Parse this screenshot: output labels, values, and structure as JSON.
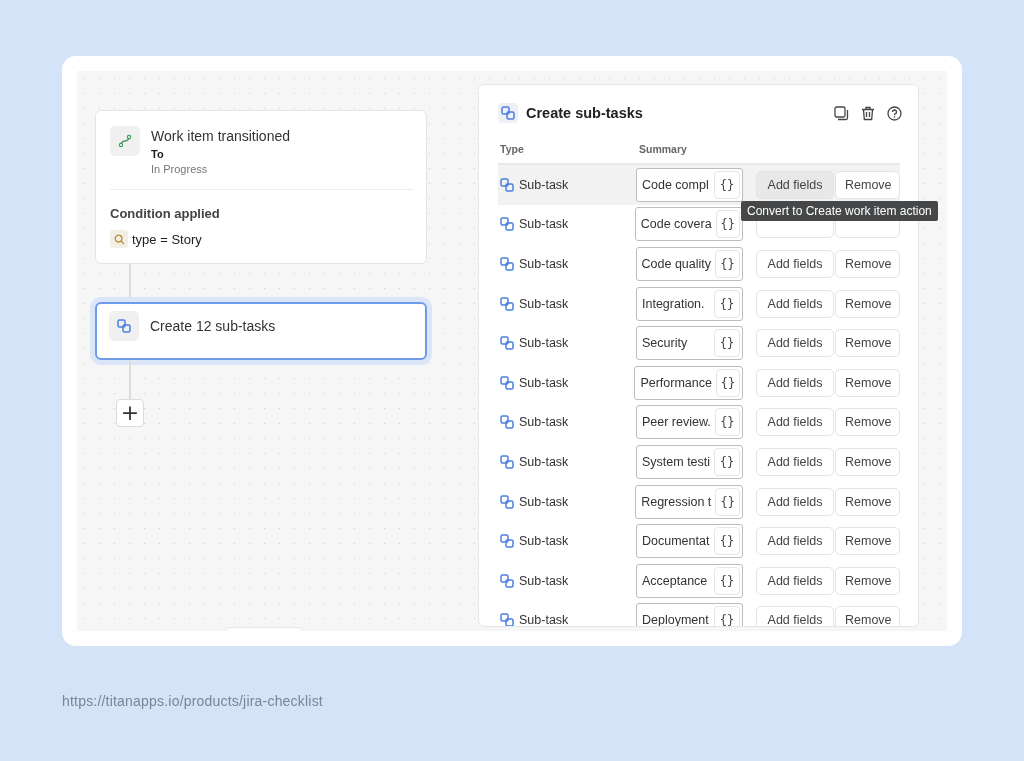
{
  "trigger": {
    "title": "Work item transitioned",
    "label": "To",
    "status": "In Progress",
    "condition_heading": "Condition applied",
    "condition": "type = Story"
  },
  "action": {
    "title": "Create 12 sub-tasks",
    "selected": true
  },
  "add_button": {
    "label": "+"
  },
  "panel": {
    "title": "Create sub-tasks",
    "columns": [
      "Type",
      "Summary"
    ],
    "rows": [
      {
        "type": "Sub-task",
        "summary": "Code compl",
        "add": "Add fields",
        "remove": "Remove",
        "hovered": true
      },
      {
        "type": "Sub-task",
        "summary": "Code covera",
        "hovered": false
      },
      {
        "type": "Sub-task",
        "summary": "Code quality",
        "add": "Add fields",
        "remove": "Remove",
        "hovered": false
      },
      {
        "type": "Sub-task",
        "summary": "Integration.",
        "add": "Add fields",
        "remove": "Remove",
        "hovered": false
      },
      {
        "type": "Sub-task",
        "summary": "Security",
        "add": "Add fields",
        "remove": "Remove",
        "hovered": false
      },
      {
        "type": "Sub-task",
        "summary": "Performance",
        "add": "Add fields",
        "remove": "Remove",
        "hovered": false
      },
      {
        "type": "Sub-task",
        "summary": "Peer review.",
        "add": "Add fields",
        "remove": "Remove",
        "hovered": false
      },
      {
        "type": "Sub-task",
        "summary": "System testi",
        "add": "Add fields",
        "remove": "Remove",
        "hovered": false
      },
      {
        "type": "Sub-task",
        "summary": "Regression t",
        "add": "Add fields",
        "remove": "Remove",
        "hovered": false
      },
      {
        "type": "Sub-task",
        "summary": "Documentat",
        "add": "Add fields",
        "remove": "Remove",
        "hovered": false
      },
      {
        "type": "Sub-task",
        "summary": "Acceptance",
        "add": "Add fields",
        "remove": "Remove",
        "hovered": false
      },
      {
        "type": "Sub-task",
        "summary": "Deployment",
        "add": "Add fields",
        "remove": "Remove",
        "hovered": false
      }
    ],
    "variable_button": "{}"
  },
  "tooltip": {
    "text": "Convert to Create work item action"
  },
  "source_url": "https://titanapps.io/products/jira-checklist"
}
